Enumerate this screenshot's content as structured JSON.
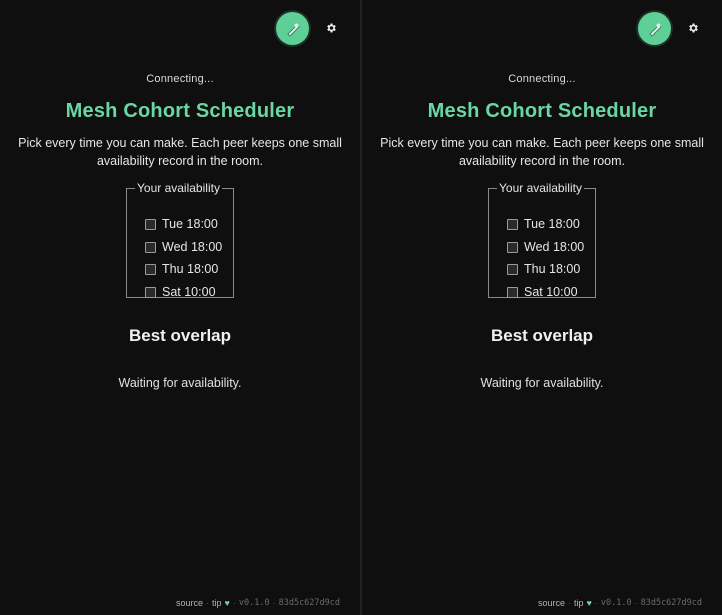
{
  "panes": [
    {
      "status": "Connecting...",
      "title": "Mesh Cohort Scheduler",
      "intro": "Pick every time you can make. Each peer keeps one small availability record in the room.",
      "availability": {
        "legend": "Your availability",
        "slots": [
          "Tue 18:00",
          "Wed 18:00",
          "Thu 18:00",
          "Sat 10:00"
        ]
      },
      "best_heading": "Best overlap",
      "waiting": "Waiting for availability.",
      "footer": {
        "source": "source",
        "tip": "tip",
        "version": "v0.1.0",
        "hash": "83d5c627d9cd"
      }
    },
    {
      "status": "Connecting...",
      "title": "Mesh Cohort Scheduler",
      "intro": "Pick every time you can make. Each peer keeps one small availability record in the room.",
      "availability": {
        "legend": "Your availability",
        "slots": [
          "Tue 18:00",
          "Wed 18:00",
          "Thu 18:00",
          "Sat 10:00"
        ]
      },
      "best_heading": "Best overlap",
      "waiting": "Waiting for availability.",
      "footer": {
        "source": "source",
        "tip": "tip",
        "version": "v0.1.0",
        "hash": "83d5c627d9cd"
      }
    }
  ],
  "icons": {
    "avatar": "avatar-icon",
    "settings": "gear-icon",
    "tip": "heart-icon"
  },
  "colors": {
    "accent": "#6bd6a3",
    "avatar_bg": "#5fcf98",
    "background": "#0f0f0f"
  }
}
